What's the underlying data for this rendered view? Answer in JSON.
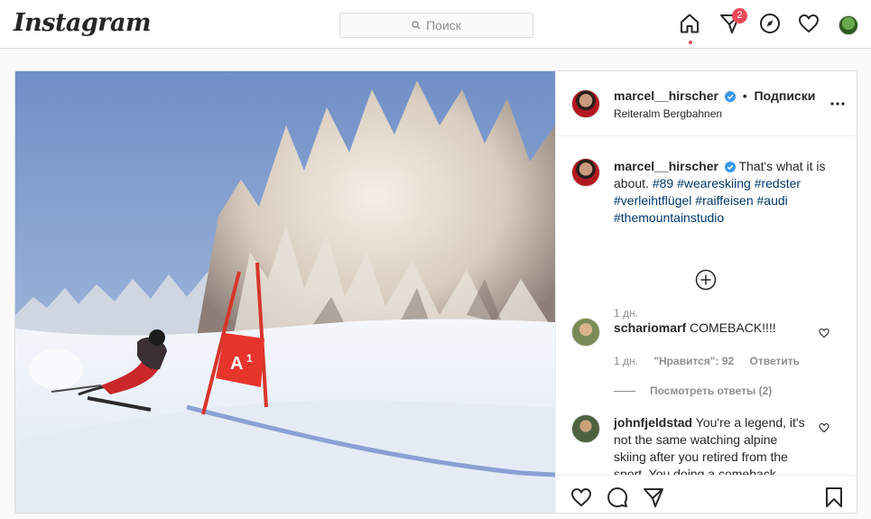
{
  "brand": {
    "logo_text": "Instagram"
  },
  "search": {
    "placeholder": "Поиск"
  },
  "nav": {
    "icons": [
      "home-icon",
      "direct-icon",
      "explore-icon",
      "activity-heart-icon",
      "profile-avatar"
    ],
    "direct_badge": "2"
  },
  "post": {
    "author": {
      "username": "marcel__hirscher",
      "follow_separator": "•",
      "follow_label": "Подписки",
      "location": "Reiteralm Bergbahnen"
    },
    "caption": {
      "username": "marcel__hirscher",
      "text": "That's what it is about.",
      "hashtags": [
        "#89",
        "#weareskiing",
        "#redster",
        "#verleihtflügel",
        "#raiffeisen",
        "#audi",
        "#themountainstudio"
      ],
      "time": "1 дн."
    },
    "comments": [
      {
        "username": "schariomarf",
        "text": "COMEBACK!!!!",
        "time": "1 дн.",
        "likes_label": "\"Нравится\": 92",
        "reply_label": "Ответить",
        "view_replies": "Посмотреть ответы (2)"
      },
      {
        "username": "johnfjeldstad",
        "text": "You're a legend, it's not the same watching alpine skiing after you retired from the sport. You doing a comeback"
      }
    ]
  },
  "colors": {
    "accent_link": "#00376b",
    "badge": "#ed4956",
    "verified": "#3897f0",
    "gate_red": "#e8352b"
  }
}
